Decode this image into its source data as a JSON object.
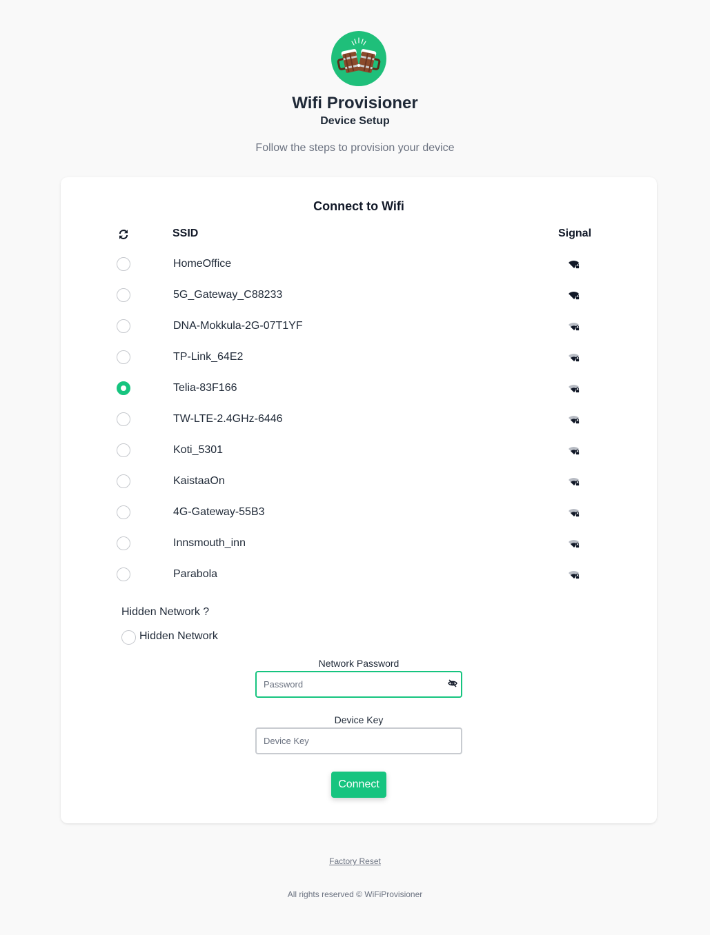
{
  "header": {
    "title": "Wifi Provisioner",
    "subtitle": "Device Setup",
    "tagline": "Follow the steps to provision your device",
    "logo": "beer-mugs-icon"
  },
  "colors": {
    "accent": "#16c47f",
    "logo_bg": "#1fbf7a"
  },
  "card": {
    "title": "Connect to Wifi",
    "columns": {
      "ssid": "SSID",
      "signal": "Signal"
    },
    "refresh_icon": "refresh-icon",
    "networks": [
      {
        "ssid": "HomeOffice",
        "signal": "strong",
        "locked": true,
        "selected": false
      },
      {
        "ssid": "5G_Gateway_C88233",
        "signal": "strong",
        "locked": true,
        "selected": false
      },
      {
        "ssid": "DNA-Mokkula-2G-07T1YF",
        "signal": "medium",
        "locked": true,
        "selected": false
      },
      {
        "ssid": "TP-Link_64E2",
        "signal": "medium",
        "locked": true,
        "selected": false
      },
      {
        "ssid": "Telia-83F166",
        "signal": "medium",
        "locked": true,
        "selected": true
      },
      {
        "ssid": "TW-LTE-2.4GHz-6446",
        "signal": "medium",
        "locked": true,
        "selected": false
      },
      {
        "ssid": "Koti_5301",
        "signal": "medium",
        "locked": true,
        "selected": false
      },
      {
        "ssid": "KaistaaOn",
        "signal": "medium",
        "locked": true,
        "selected": false
      },
      {
        "ssid": "4G-Gateway-55B3",
        "signal": "medium",
        "locked": true,
        "selected": false
      },
      {
        "ssid": "Innsmouth_inn",
        "signal": "medium",
        "locked": true,
        "selected": false
      },
      {
        "ssid": "Parabola",
        "signal": "medium",
        "locked": true,
        "selected": false
      }
    ],
    "hidden_question": "Hidden Network ?",
    "hidden_option": "Hidden Network",
    "password_label": "Network Password",
    "password_placeholder": "Password",
    "password_value": "",
    "password_toggle_icon": "eye-slash-icon",
    "device_key_label": "Device Key",
    "device_key_placeholder": "Device Key",
    "device_key_value": "",
    "connect_label": "Connect"
  },
  "footer": {
    "reset_link": "Factory Reset",
    "copyright": "All rights reserved © WiFiProvisioner"
  }
}
